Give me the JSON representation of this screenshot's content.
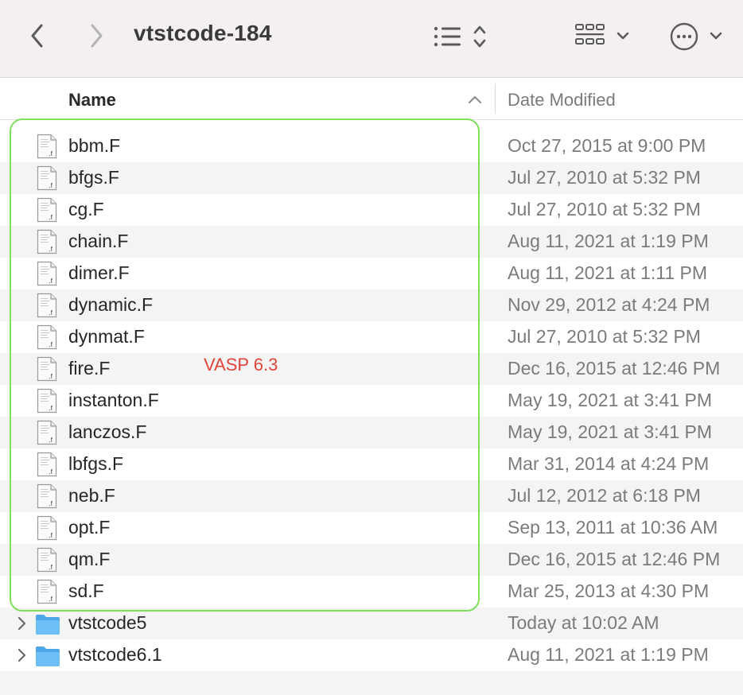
{
  "window": {
    "title": "vtstcode-184",
    "back_icon": "chevron-left-icon",
    "forward_icon": "chevron-right-icon",
    "sort_icon": "list-sort-icon",
    "view_icon": "grid-view-icon",
    "more_icon": "ellipsis-circle-icon"
  },
  "columns": {
    "name": "Name",
    "date": "Date Modified"
  },
  "files": [
    {
      "name": "bbm.F",
      "date": "Oct 27, 2015 at 9:00 PM"
    },
    {
      "name": "bfgs.F",
      "date": "Jul 27, 2010 at 5:32 PM"
    },
    {
      "name": "cg.F",
      "date": "Jul 27, 2010 at 5:32 PM"
    },
    {
      "name": "chain.F",
      "date": "Aug 11, 2021 at 1:19 PM"
    },
    {
      "name": "dimer.F",
      "date": "Aug 11, 2021 at 1:11 PM"
    },
    {
      "name": "dynamic.F",
      "date": "Nov 29, 2012 at 4:24 PM"
    },
    {
      "name": "dynmat.F",
      "date": "Jul 27, 2010 at 5:32 PM"
    },
    {
      "name": "fire.F",
      "date": "Dec 16, 2015 at 12:46 PM"
    },
    {
      "name": "instanton.F",
      "date": "May 19, 2021 at 3:41 PM"
    },
    {
      "name": "lanczos.F",
      "date": "May 19, 2021 at 3:41 PM"
    },
    {
      "name": "lbfgs.F",
      "date": "Mar 31, 2014 at 4:24 PM"
    },
    {
      "name": "neb.F",
      "date": "Jul 12, 2012 at 6:18 PM"
    },
    {
      "name": "opt.F",
      "date": "Sep 13, 2011 at 10:36 AM"
    },
    {
      "name": "qm.F",
      "date": "Dec 16, 2015 at 12:46 PM"
    },
    {
      "name": "sd.F",
      "date": "Mar 25, 2013 at 4:30 PM"
    }
  ],
  "folders": [
    {
      "name": "vtstcode5",
      "date": "Today at 10:02 AM"
    },
    {
      "name": "vtstcode6.1",
      "date": "Aug 11, 2021 at 1:19 PM"
    }
  ],
  "annotation": {
    "text": "VASP 6.3",
    "color": "#e0443a",
    "highlight_color": "#7ee05a"
  }
}
